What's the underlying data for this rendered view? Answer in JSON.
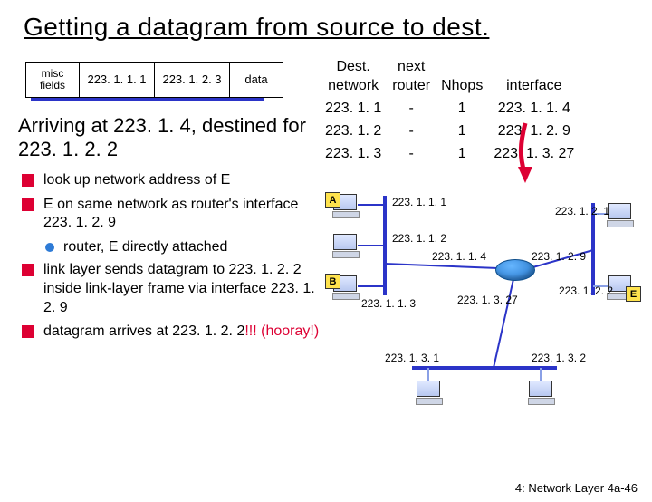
{
  "title": "Getting a datagram from source to dest.",
  "packet": {
    "misc": "misc\nfields",
    "src": "223. 1. 1. 1",
    "dst": "223. 1. 2. 3",
    "data": "data"
  },
  "subhead": "Arriving at 223. 1. 4, destined for 223. 1. 2. 2",
  "bullets": [
    {
      "type": "b1",
      "text": "look up network address of E"
    },
    {
      "type": "b1",
      "text": "E on same network as router's interface 223. 1. 2. 9"
    },
    {
      "type": "b2",
      "text": "router, E directly attached"
    },
    {
      "type": "b1",
      "text": "link layer sends datagram to 223. 1. 2. 2 inside link-layer frame via interface 223. 1. 2. 9"
    },
    {
      "type": "b1",
      "text": "datagram arrives at 223. 1. 2. 2"
    },
    {
      "type": "hooray",
      "text": "!!! (hooray!)"
    }
  ],
  "routing_table": {
    "headers": [
      "Dest.\nnetwork",
      "next\nrouter",
      "Nhops",
      "interface"
    ],
    "rows": [
      [
        "223. 1. 1",
        "-",
        "1",
        "223. 1. 1. 4"
      ],
      [
        "223. 1. 2",
        "-",
        "1",
        "223. 1. 2. 9"
      ],
      [
        "223. 1. 3",
        "-",
        "1",
        "223. 1. 3. 27"
      ]
    ]
  },
  "hosts": {
    "A": "A",
    "B": "B",
    "E": "E"
  },
  "ips": {
    "a": "223. 1. 1. 1",
    "b_top": "223. 1. 1. 2",
    "b": "223. 1. 1. 3",
    "r_left": "223. 1. 1. 4",
    "r_right": "223. 1. 2. 9",
    "r_bottom": "223. 1. 3. 27",
    "net21": "223. 1. 2. 1",
    "e": "223. 1. 2. 2",
    "net31": "223. 1. 3. 1",
    "net32": "223. 1. 3. 2"
  },
  "footer": "4: Network Layer   4a-46"
}
